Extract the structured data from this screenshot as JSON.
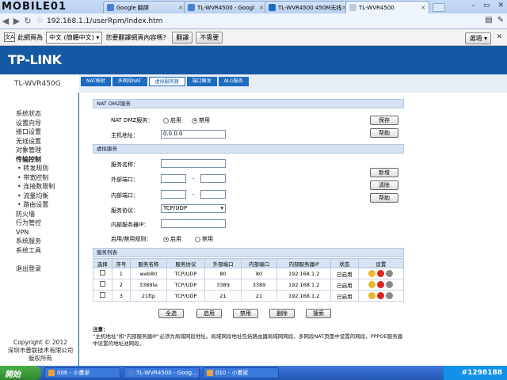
{
  "browser": {
    "logo": "MOBILE01",
    "tabs": [
      {
        "label": "Google 翻譯",
        "icon": "google-translate-icon",
        "color": "#4a7fd8"
      },
      {
        "label": "TL-WVR4500 - Googl",
        "icon": "google-icon",
        "color": "#4a7fd8"
      },
      {
        "label": "TL-WVR4500 450M无线",
        "icon": "tp-icon",
        "color": "#1e6cc0"
      },
      {
        "label": "TL-WVR4500",
        "icon": "page-icon",
        "color": "#9ab"
      }
    ],
    "url": "192.168.1.1/userRpm/Index.htm",
    "translate_bar": {
      "prefix": "此網頁為",
      "language": "中文 (簡體中文)",
      "question": "您要翻譯網頁內容嗎？",
      "translate_btn": "翻譯",
      "no_btn": "不需要",
      "options_btn": "選項"
    }
  },
  "router": {
    "brand": "TP-LINK",
    "model": "TL-WVR450G",
    "subtabs": [
      "NAT映射",
      "多网段NAT",
      "虚拟服务器",
      "端口触发",
      "ALG服务"
    ],
    "active_subtab": 2,
    "sidebar": [
      {
        "label": "系统状态",
        "type": "main"
      },
      {
        "label": "设置向导",
        "type": "main"
      },
      {
        "label": "接口设置",
        "type": "main"
      },
      {
        "label": "无线设置",
        "type": "main"
      },
      {
        "label": "对象管理",
        "type": "main"
      },
      {
        "label": "传输控制",
        "type": "bold"
      },
      {
        "label": "• 转发规则",
        "type": "sub"
      },
      {
        "label": "• 带宽控制",
        "type": "sub"
      },
      {
        "label": "• 连接数限制",
        "type": "sub"
      },
      {
        "label": "• 流量均衡",
        "type": "sub"
      },
      {
        "label": "• 路由设置",
        "type": "sub"
      },
      {
        "label": "防火墙",
        "type": "main"
      },
      {
        "label": "行为管控",
        "type": "main"
      },
      {
        "label": "VPN",
        "type": "main"
      },
      {
        "label": "系统服务",
        "type": "main"
      },
      {
        "label": "系统工具",
        "type": "main"
      },
      {
        "label": "退出登录",
        "type": "logout"
      }
    ],
    "copyright": [
      "Copyright © 2012",
      "深圳市普联技术有限公司",
      "版权所有"
    ]
  },
  "dmz": {
    "title": "NAT DMZ服务",
    "label_service": "NAT DMZ服务：",
    "opt_enable": "启用",
    "opt_disable": "禁用",
    "label_host": "主机地址：",
    "host_value": "0.0.0.0",
    "save_btn": "保存",
    "help_btn": "帮助"
  },
  "vs": {
    "title": "虚拟服务",
    "label_name": "服务名称：",
    "label_ext": "外部端口：",
    "label_int": "内部端口：",
    "label_proto": "服务协议：",
    "proto_value": "TCP/UDP",
    "label_ip": "内部服务器IP：",
    "label_rule": "启用/禁用规则：",
    "opt_enable": "启用",
    "opt_disable": "禁用",
    "dash": "-",
    "add_btn": "新增",
    "clear_btn": "清除",
    "help_btn": "帮助"
  },
  "list": {
    "title": "服务列表",
    "headers": [
      "选择",
      "序号",
      "服务名称",
      "服务协议",
      "外部端口",
      "内部端口",
      "内部服务器IP",
      "状态",
      "设置"
    ],
    "rows": [
      {
        "num": "1",
        "name": "web80",
        "proto": "TCP/UDP",
        "ext": "80",
        "int": "80",
        "ip": "192.168.1.2",
        "status": "已启用"
      },
      {
        "num": "2",
        "name": "3389te",
        "proto": "TCP/UDP",
        "ext": "3389",
        "int": "3389",
        "ip": "192.168.1.2",
        "status": "已启用"
      },
      {
        "num": "3",
        "name": "21ftp",
        "proto": "TCP/UDP",
        "ext": "21",
        "int": "21",
        "ip": "192.168.1.2",
        "status": "已启用"
      }
    ],
    "buttons": [
      "全选",
      "启用",
      "禁用",
      "删除",
      "搜索"
    ]
  },
  "note": {
    "title": "注意：",
    "text": "“主机地址”和“内部服务器IP”必须为局域网段地址。局域网段地址包括路由器局域网网段、多网段NAT页面中设置的网段、PPPOE服务器中设置的地址池网段。"
  },
  "taskbar": {
    "start": "開始",
    "tasks": [
      {
        "label": "006 - 小畫家",
        "color": "#e8a33a"
      },
      {
        "label": "TL-WVR4500 - Goog...",
        "color": "#4a7fd8"
      },
      {
        "label": "010 - 小畫家",
        "color": "#e8a33a"
      }
    ],
    "watermark": "#1298188"
  }
}
